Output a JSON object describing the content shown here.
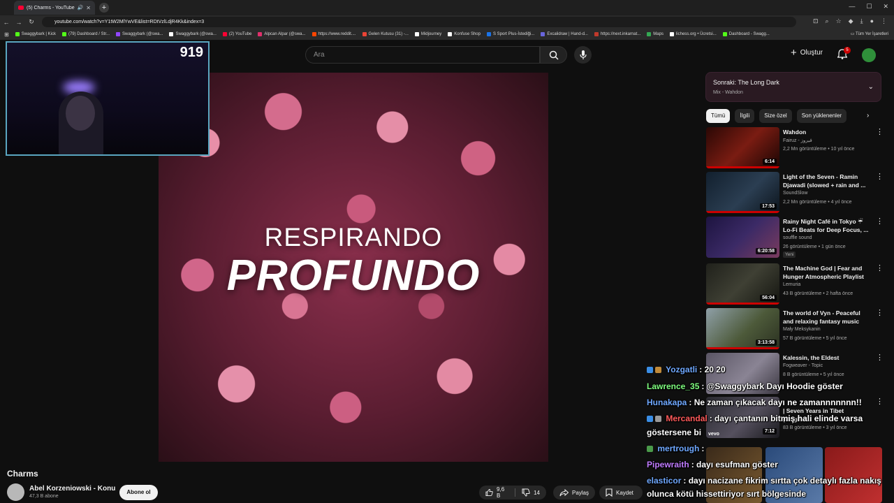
{
  "browser": {
    "tab_title": "(5) Charms - YouTube",
    "url": "youtube.com/watch?v=Y1tW2MlYwVE&list=RDtVzlLdjR4Kk&index=3",
    "bookmarks": [
      {
        "label": "Swaggybark | Kick",
        "color": "#53fc18"
      },
      {
        "label": "(79) Dashboard / Str...",
        "color": "#53fc18"
      },
      {
        "label": "Swaggybark (@swa...",
        "color": "#9146ff"
      },
      {
        "label": "Swaggybark (@swa...",
        "color": "#ffffff"
      },
      {
        "label": "(2) YouTube",
        "color": "#ff0033"
      },
      {
        "label": "Alpcan Alpar (@swa...",
        "color": "#e1306c"
      },
      {
        "label": "https://www.reddit....",
        "color": "#ff4500"
      },
      {
        "label": "Gelen Kutusu (31) -...",
        "color": "#ea4335"
      },
      {
        "label": "Midjourney",
        "color": "#ffffff"
      },
      {
        "label": "Konfuse Shop",
        "color": "#ffffff"
      },
      {
        "label": "S Sport Plus-İstediği...",
        "color": "#1a73e8"
      },
      {
        "label": "Excalidraw | Hand-d...",
        "color": "#6965db"
      },
      {
        "label": "https://next.inkarnat...",
        "color": "#c0392b"
      },
      {
        "label": "Maps",
        "color": "#34a853"
      },
      {
        "label": "lichess.org • Ücretsi...",
        "color": "#ffffff"
      },
      {
        "label": "Dashboard - Swagg...",
        "color": "#53fc18"
      }
    ],
    "all_bookmarks": "Tüm Yer İşaretleri"
  },
  "header": {
    "search_placeholder": "Ara",
    "create_label": "Oluştur",
    "notification_count": "5"
  },
  "webcam": {
    "viewer_count": "919"
  },
  "video": {
    "overlay_line1": "RESPIRANDO",
    "overlay_line2": "PROFUNDO",
    "title": "Charms",
    "channel": "Abel Korzeniowski - Konu",
    "subscribers": "47,3 B abone",
    "subscribe_label": "Abone ol",
    "likes": "9,6 B",
    "dislikes": "14",
    "share_label": "Paylaş",
    "save_label": "Kaydet"
  },
  "sidebar": {
    "up_next_title": "Sonraki: The Long Dark",
    "up_next_sub": "Mix - Wahdon",
    "chips": [
      "Tümü",
      "İlgili",
      "Size özel",
      "Son yüklenenler"
    ],
    "recommendations": [
      {
        "title": "Wahdon",
        "channel": "Fairuz - فيروز",
        "meta": "2,2 Mn görüntüleme • 10 yıl önce",
        "duration": "6:14",
        "thumb": "#7a1c12",
        "badge": ""
      },
      {
        "title": "Light of the Seven - Ramin Djawadi (slowed + rain and ...",
        "channel": "SoundSlow",
        "meta": "2,2 Mn görüntüleme • 4 yıl önce",
        "duration": "17:53",
        "thumb": "#2b3e52",
        "badge": ""
      },
      {
        "title": "Rainy Night Café in Tokyo ☔ Lo-Fi Beats for Deep Focus, ...",
        "channel": "souffle sound",
        "meta": "26 görüntüleme • 1 gün önce",
        "duration": "6:20:58",
        "thumb": "#3b2a66",
        "badge": "Yeni"
      },
      {
        "title": "The Machine God | Fear and Hunger Atmospheric Playlist",
        "channel": "Lemuria",
        "meta": "43 B görüntüleme • 2 hafta önce",
        "duration": "56:04",
        "thumb": "#3f4034",
        "badge": ""
      },
      {
        "title": "The world of Vyn - Peaceful and relaxing fantasy music (Enderal)",
        "channel": "Mały Meksykanin",
        "meta": "57 B görüntüleme • 5 yıl önce",
        "duration": "3:13:58",
        "thumb": "#4d5a3a",
        "badge": ""
      },
      {
        "title": "Kalessin, the Eldest",
        "channel": "Fogweaver - Topic",
        "meta": "8 B görüntüleme • 5 yıl önce",
        "duration": "",
        "thumb": "#8a8494",
        "badge": ""
      }
    ],
    "partial_item": {
      "title": "| Seven Years in Tibet (Original...",
      "meta": "83 B görüntüleme • 3 yıl önce",
      "duration": "7:12",
      "brand": "vevo"
    }
  },
  "chat": [
    {
      "user": "Yozgatli",
      "color": "#6fa8ff",
      "text": "20 20"
    },
    {
      "user": "Lawrence_35",
      "color": "#7fff7f",
      "text": "@Swaggybark Dayı Hoodie göster"
    },
    {
      "user": "Hunakapa",
      "color": "#6fa8ff",
      "text": "Ne zaman çıkacak dayı ne zamannnnnnn!!"
    },
    {
      "user": "Mercandal",
      "color": "#ff5a5a",
      "text": "dayı çantanın bitmiş hali elinde varsa"
    },
    {
      "user": "",
      "color": "#ffffff",
      "text": "göstersene bi"
    },
    {
      "user": "mertrough",
      "color": "#6fa8ff",
      "text": ""
    },
    {
      "user": "Pipewraith",
      "color": "#c07bff",
      "text": "dayı esufman göster"
    },
    {
      "user": "elasticor",
      "color": "#6fa8ff",
      "text": "dayı nacizane fikrim sırtta çok detaylı fazla nakış"
    },
    {
      "user": "",
      "color": "#ffffff",
      "text": "olunca kötü hissettiriyor sırt bölgesinde"
    }
  ],
  "colors": {
    "accent": "#cc0000",
    "background": "#0f0f0f",
    "webcam_border": "#5aa6c0"
  }
}
